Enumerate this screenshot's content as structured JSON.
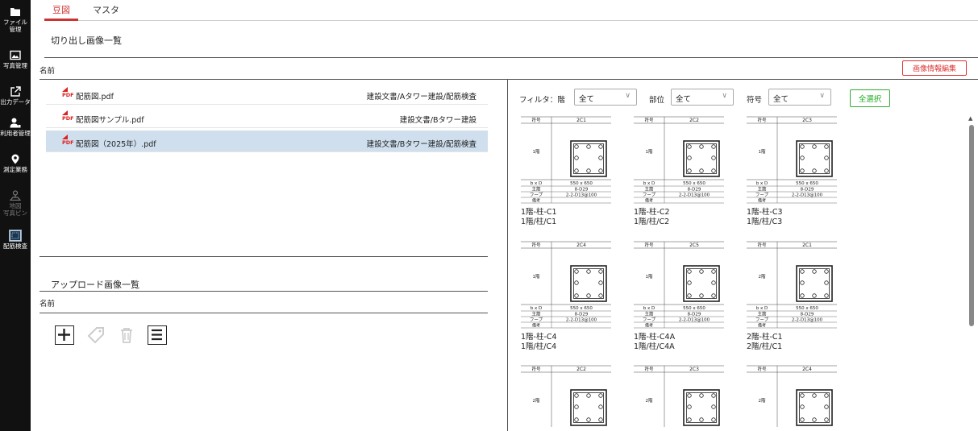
{
  "sidebar": {
    "items": [
      {
        "label": "ファイル\n管理",
        "icon": "folder-icon"
      },
      {
        "label": "写真管理",
        "icon": "image-icon"
      },
      {
        "label": "出力データ",
        "icon": "external-link-icon"
      },
      {
        "label": "利用者管理",
        "icon": "user-icon"
      },
      {
        "label": "測定業務",
        "icon": "location-pin-icon"
      },
      {
        "label": "地図\n写真ピン",
        "icon": "map-pin-icon"
      },
      {
        "label": "配筋検査",
        "icon": "grid-select-icon"
      }
    ]
  },
  "tabs": [
    {
      "label": "豆図"
    },
    {
      "label": "マスタ"
    }
  ],
  "crop_section": {
    "title": "切り出し画像一覧",
    "column_name": "名前"
  },
  "edit_button": "画像情報編集",
  "files": [
    {
      "name": "配筋図.pdf",
      "path": "建設文書/Aタワー建設/配筋検査",
      "icon_text": "PDF"
    },
    {
      "name": "配筋図サンプル.pdf",
      "path": "建設文書/Bタワー建設",
      "icon_text": "PDF"
    },
    {
      "name": "配筋図（2025年）.pdf",
      "path": "建設文書/Bタワー建設/配筋検査",
      "icon_text": "PDF"
    }
  ],
  "upload_section": {
    "title": "アップロード画像一覧",
    "column_name": "名前"
  },
  "toolbar": {
    "icons": [
      "plus-icon",
      "tag-icon",
      "trash-icon",
      "list-icon"
    ]
  },
  "filter": {
    "label": "フィルタ：階",
    "floor_value": "全て",
    "part_label": "部位",
    "part_value": "全て",
    "code_label": "符号",
    "code_value": "全て",
    "select_all": "全選択"
  },
  "table_labels": {
    "code": "符号",
    "bxd": "b x D",
    "main": "主筋",
    "hoop": "フープ",
    "note": "備考"
  },
  "thumbnails": [
    {
      "id": "2C1",
      "floor": "1階",
      "size": "550 x 650",
      "main": "8-D29",
      "hoop": "2-2-D13@100",
      "caption1": "1階-柱-C1",
      "caption2": "1階/柱/C1"
    },
    {
      "id": "2C2",
      "floor": "1階",
      "size": "550 x 650",
      "main": "8-D29",
      "hoop": "2-2-D13@100",
      "caption1": "1階-柱-C2",
      "caption2": "1階/柱/C2"
    },
    {
      "id": "2C3",
      "floor": "1階",
      "size": "550 x 650",
      "main": "8-D29",
      "hoop": "2-2-D13@100",
      "caption1": "1階-柱-C3",
      "caption2": "1階/柱/C3"
    },
    {
      "id": "2C4",
      "floor": "1階",
      "size": "550 x 650",
      "main": "8-D29",
      "hoop": "2-2-D13@100",
      "caption1": "1階-柱-C4",
      "caption2": "1階/柱/C4"
    },
    {
      "id": "2C5",
      "floor": "1階",
      "size": "550 x 650",
      "main": "8-D29",
      "hoop": "2-2-D13@100",
      "caption1": "1階-柱-C4A",
      "caption2": "1階/柱/C4A"
    },
    {
      "id": "2C1",
      "floor": "2階",
      "size": "550 x 650",
      "main": "8-D29",
      "hoop": "2-2-D13@100",
      "caption1": "2階-柱-C1",
      "caption2": "2階/柱/C1"
    },
    {
      "id": "2C2",
      "floor": "2階",
      "size": "",
      "main": "",
      "hoop": "",
      "caption1": "",
      "caption2": ""
    },
    {
      "id": "2C3",
      "floor": "2階",
      "size": "",
      "main": "",
      "hoop": "",
      "caption1": "",
      "caption2": ""
    },
    {
      "id": "2C4",
      "floor": "2階",
      "size": "",
      "main": "",
      "hoop": "",
      "caption1": "",
      "caption2": ""
    }
  ]
}
